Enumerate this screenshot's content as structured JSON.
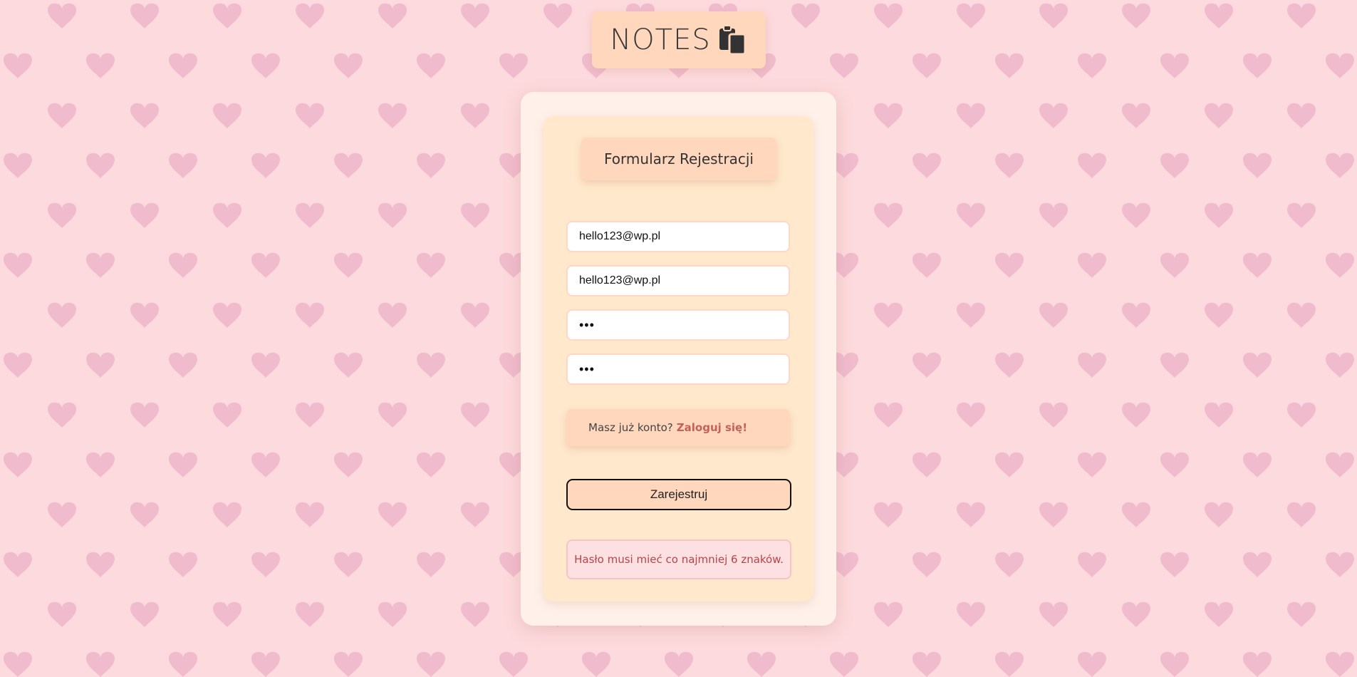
{
  "app": {
    "logo_text": "NOTES",
    "logo_icon": "clipboard-copy-icon"
  },
  "form": {
    "title": "Formularz Rejestracji",
    "email": "hello123@wp.pl",
    "email_confirm": "hello123@wp.pl",
    "password": "•••",
    "password_confirm": "•••",
    "login_prompt": "Masz już konto?",
    "login_link": "Zaloguj się!",
    "submit_label": "Zarejestruj",
    "error_message": "Hasło musi mieć co najmniej 6 znaków."
  },
  "colors": {
    "background": "#fddadd",
    "heart": "#f0bccd",
    "accent": "#ffd7bd",
    "link": "#c4625a",
    "error_text": "#b5454a"
  }
}
